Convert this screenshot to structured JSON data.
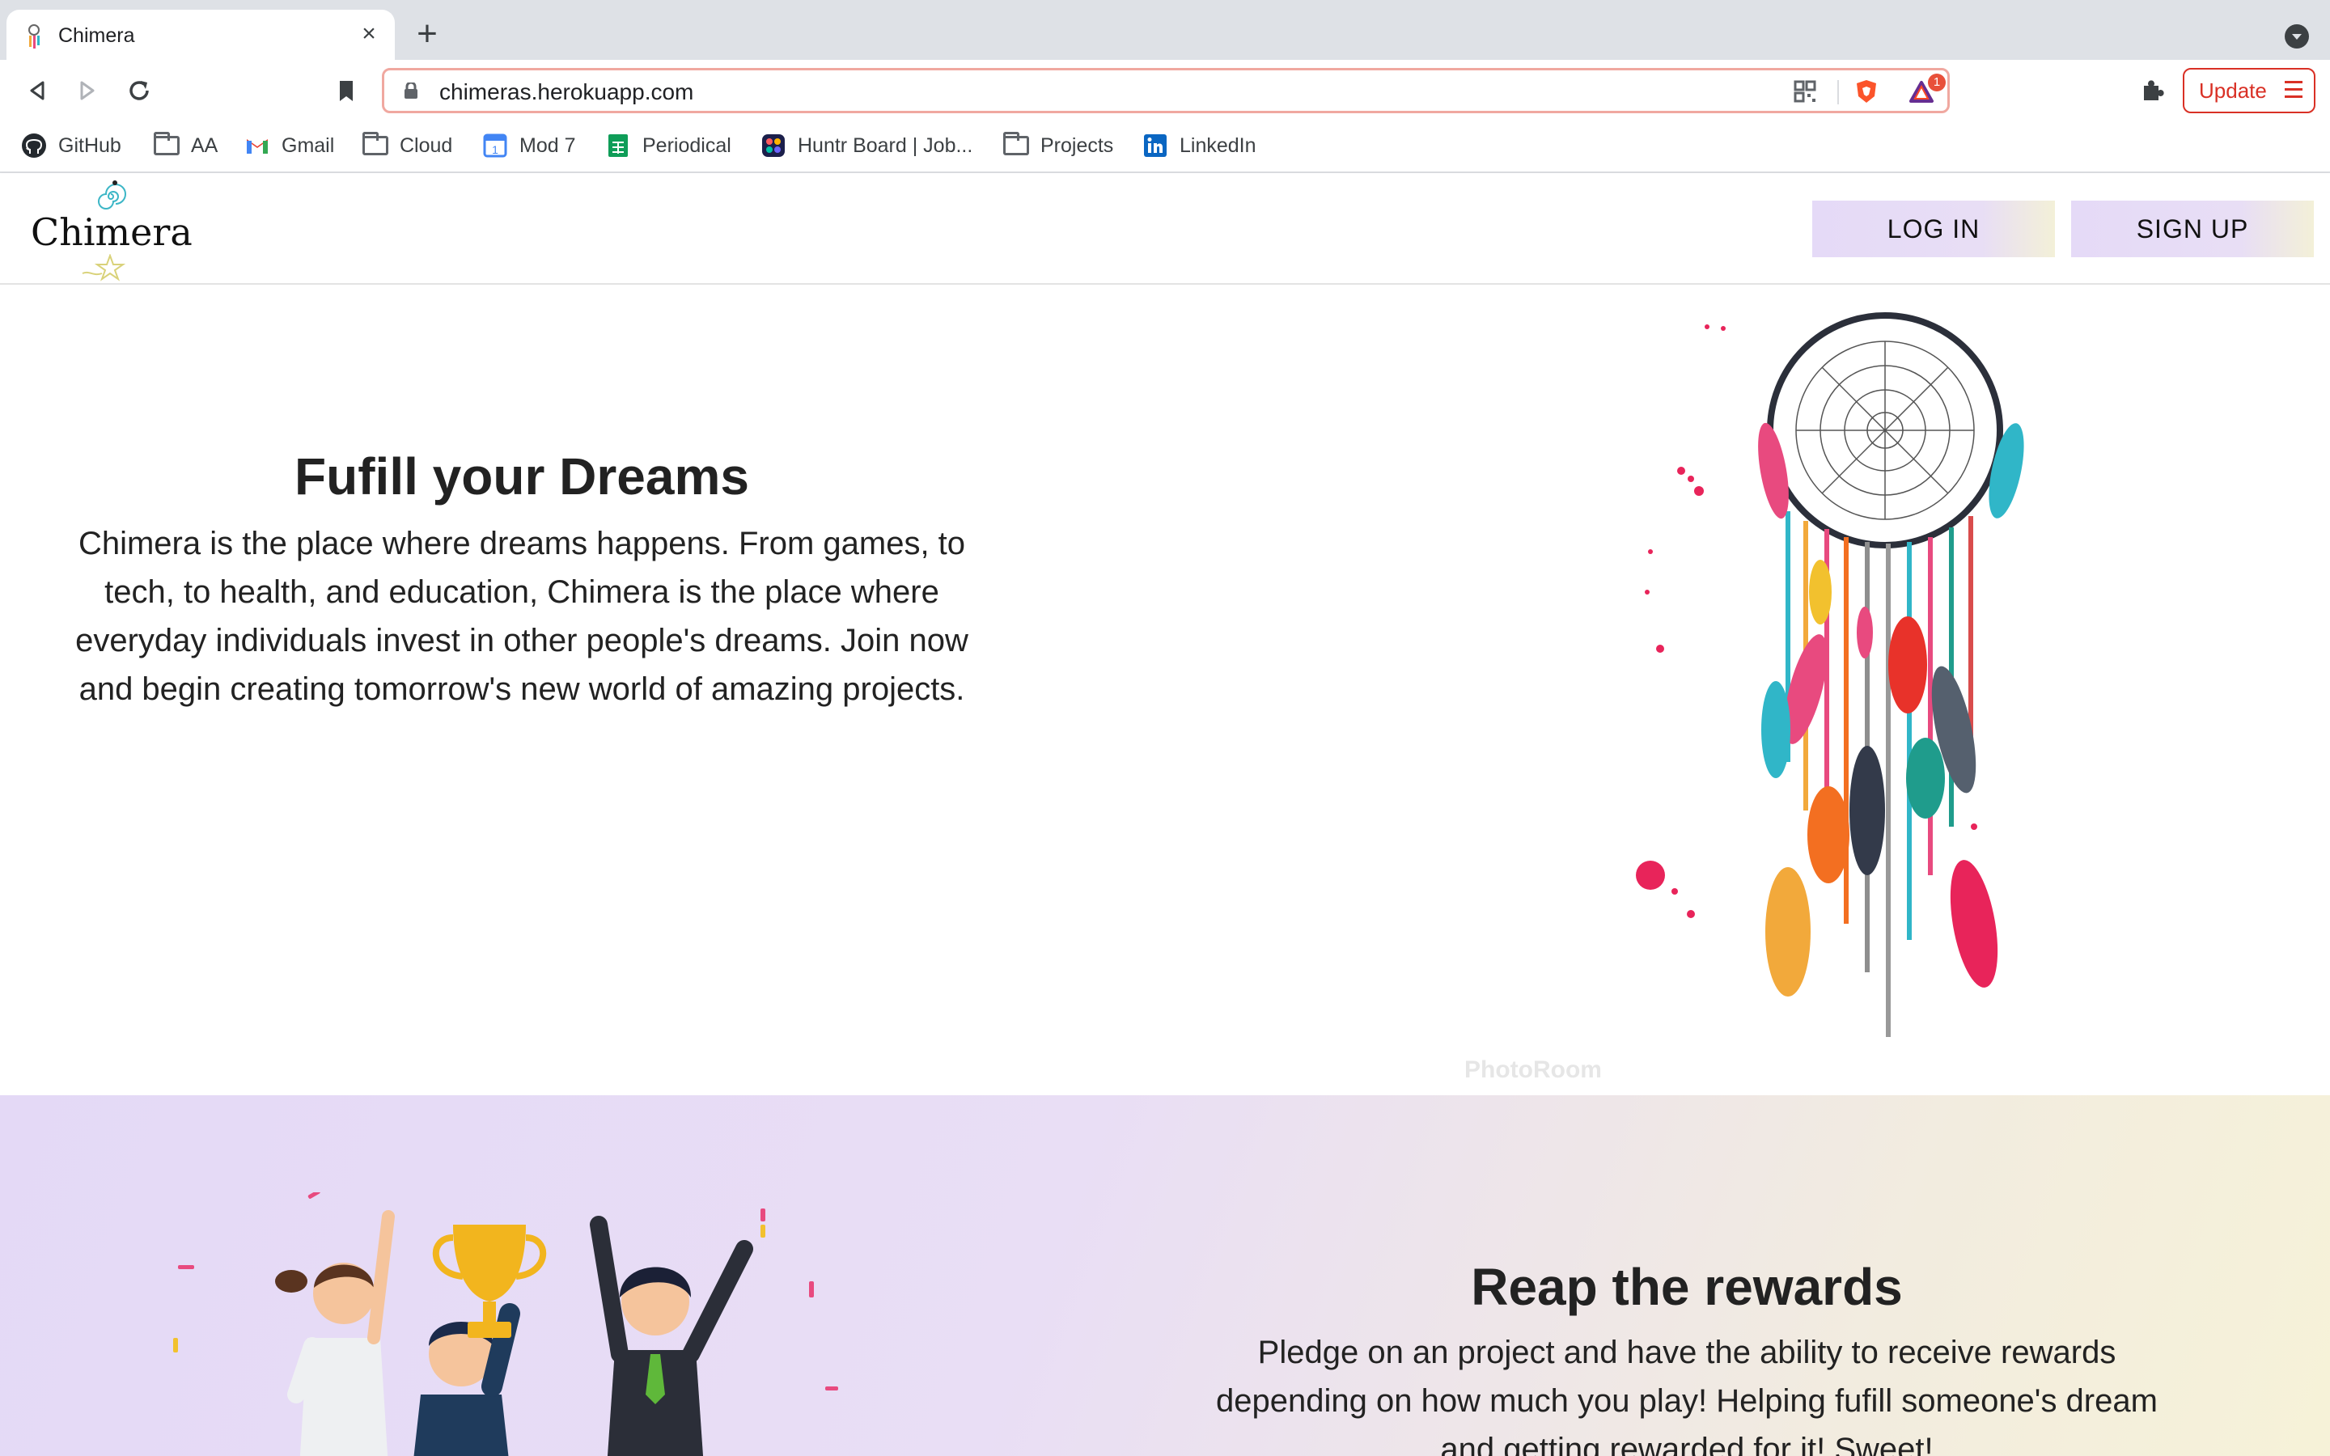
{
  "browser": {
    "tab_title": "Chimera",
    "url": "chimeras.herokuapp.com",
    "update_label": "Update",
    "brave_badge": "1",
    "bookmarks": [
      {
        "label": "GitHub",
        "icon": "github-icon"
      },
      {
        "label": "AA",
        "icon": "folder-icon"
      },
      {
        "label": "Gmail",
        "icon": "gmail-icon"
      },
      {
        "label": "Cloud",
        "icon": "folder-icon"
      },
      {
        "label": "Mod 7",
        "icon": "calendar-icon"
      },
      {
        "label": "Periodical",
        "icon": "sheets-icon"
      },
      {
        "label": "Huntr Board | Job...",
        "icon": "huntr-icon"
      },
      {
        "label": "Projects",
        "icon": "folder-icon"
      },
      {
        "label": "LinkedIn",
        "icon": "linkedin-icon"
      }
    ]
  },
  "header": {
    "logo_text": "Chimera",
    "login_label": "LOG IN",
    "signup_label": "SIGN UP"
  },
  "hero": {
    "title": "Fufill your Dreams",
    "text": "Chimera is the place where dreams happens. From games, to tech, to health, and education, Chimera is the place where everyday individuals invest in other people's dreams. Join now and begin creating tomorrow's new world of amazing projects.",
    "watermark": "PhotoRoom"
  },
  "rewards": {
    "title": "Reap the rewards",
    "text": "Pledge on an project and have the ability to receive rewards depending on how much you play! Helping fufill someone's dream and getting rewarded for it! Sweet!"
  },
  "colors": {
    "button_gradient_start": "#e5daf7",
    "button_gradient_end": "#f3f0d8",
    "update_red": "#d93025"
  }
}
